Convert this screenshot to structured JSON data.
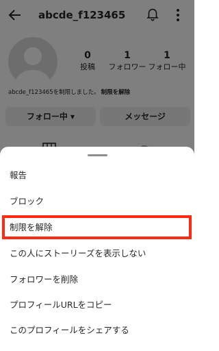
{
  "header": {
    "username": "abcde_f123465"
  },
  "profile": {
    "stats": [
      {
        "value": "0",
        "label": "投稿"
      },
      {
        "value": "1",
        "label": "フォロワー"
      },
      {
        "value": "1",
        "label": "フォロー中"
      }
    ],
    "notice_text": "abcde_f123465を制限しました。",
    "notice_link": "制限を解除",
    "follow_button": "フォロー中",
    "message_button": "メッセージ"
  },
  "sheet": {
    "items": [
      {
        "label": "報告"
      },
      {
        "label": "ブロック"
      },
      {
        "label": "制限を解除"
      },
      {
        "label": "この人にストーリーズを表示しない"
      },
      {
        "label": "フォロワーを削除"
      },
      {
        "label": "プロフィールURLをコピー"
      },
      {
        "label": "このプロフィールをシェアする"
      }
    ],
    "highlighted_item": "制限を解除"
  },
  "colors": {
    "highlight_border": "#ff2a10",
    "overlay": "rgba(0,0,0,0.5)"
  }
}
